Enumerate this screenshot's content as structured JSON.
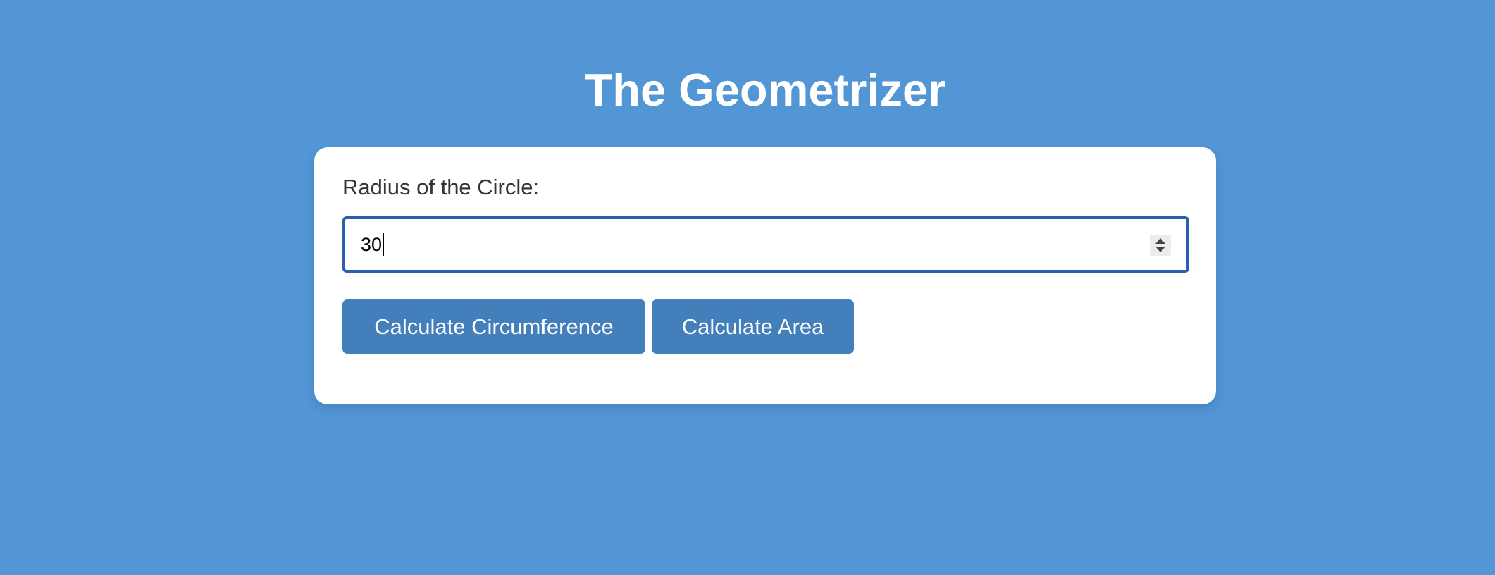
{
  "app": {
    "title": "The Geometrizer"
  },
  "form": {
    "radius_label": "Radius of the Circle:",
    "radius_value": "30",
    "stepper_icon": "number-stepper-icon"
  },
  "actions": {
    "circumference_label": "Calculate Circumference",
    "area_label": "Calculate Area"
  },
  "colors": {
    "background": "#5296d5",
    "card": "#ffffff",
    "button": "#437fba",
    "input_focus_border": "#2a5fb1"
  }
}
